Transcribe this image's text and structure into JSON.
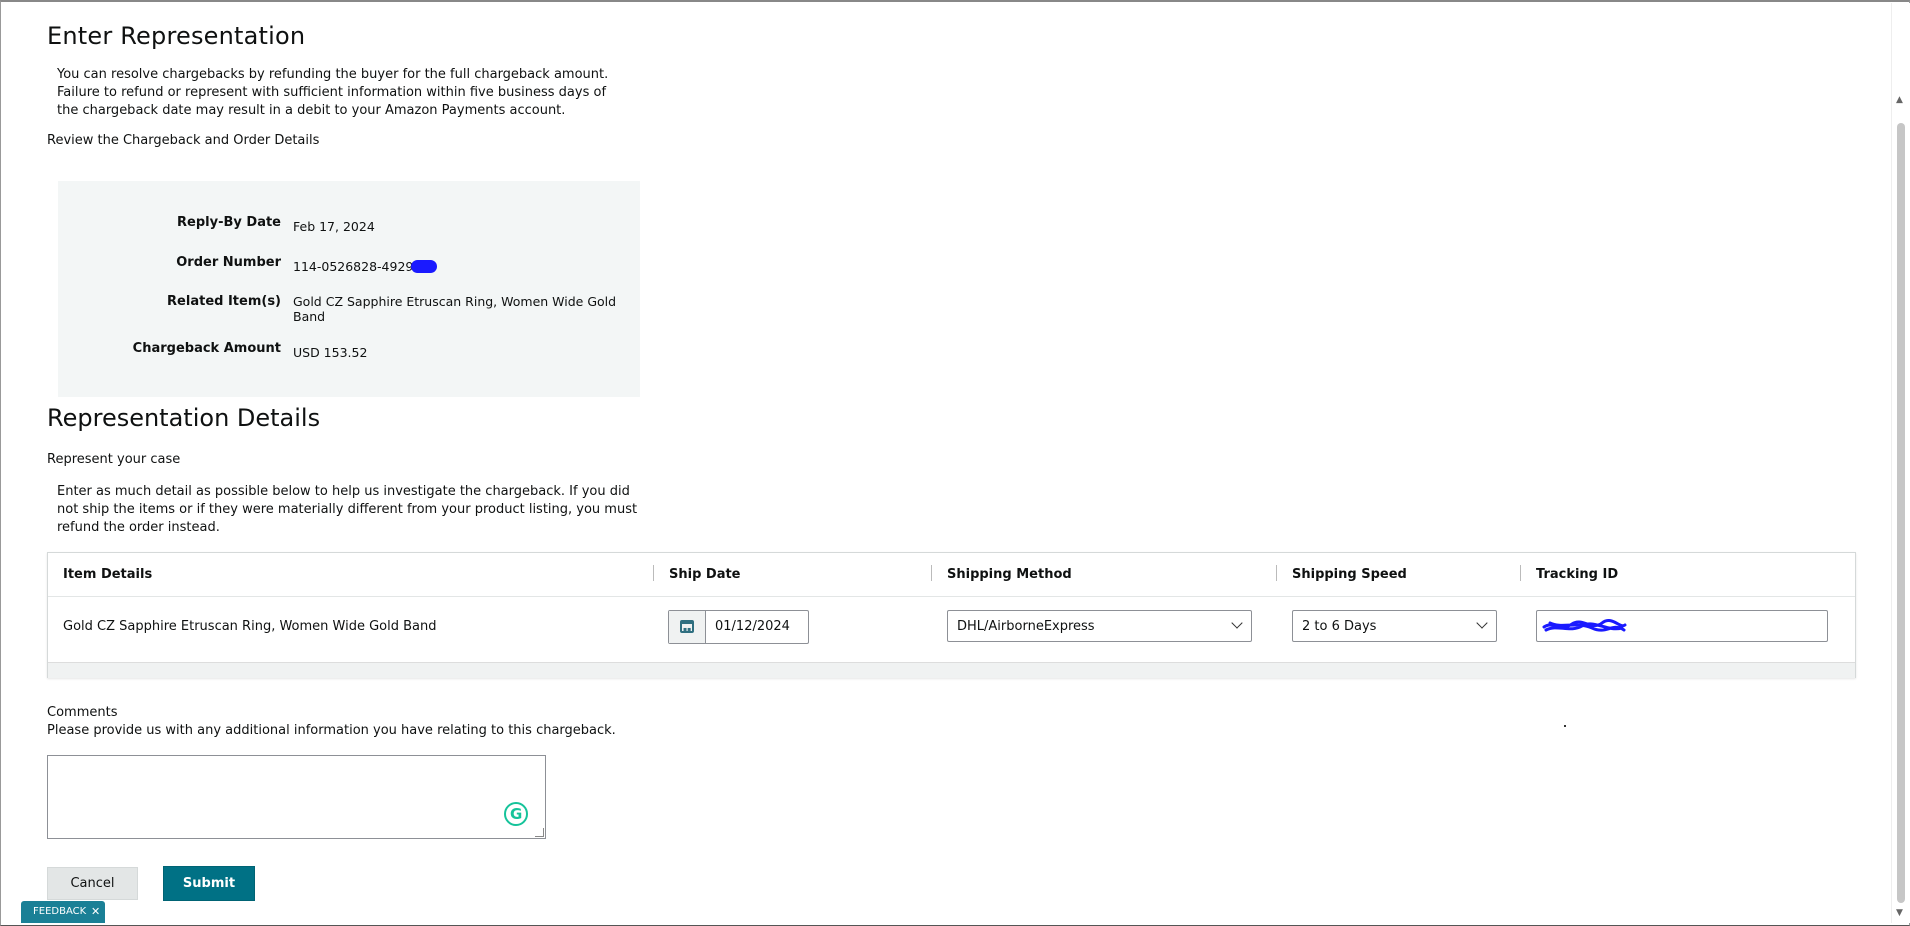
{
  "page": {
    "title": "Enter Representation",
    "intro": "You can resolve chargebacks by refunding the buyer for the full chargeback amount. Failure to refund or represent with sufficient information within five business days of the chargeback date may result in a debit to your Amazon Payments account.",
    "review_heading": "Review the Chargeback and Order Details"
  },
  "details": {
    "reply_by_label": "Reply-By Date",
    "reply_by_value": "Feb 17, 2024",
    "order_number_label": "Order Number",
    "order_number_value": "114-0526828-4929",
    "related_items_label": "Related Item(s)",
    "related_items_value": "Gold CZ Sapphire Etruscan Ring, Women Wide Gold Band",
    "chargeback_amount_label": "Chargeback Amount",
    "chargeback_amount_value": "USD 153.52"
  },
  "representation": {
    "title": "Representation Details",
    "subtitle": "Represent your case",
    "instructions": "Enter as much detail as possible below to help us investigate the chargeback. If you did not ship the items or if they were materially different from your product listing, you must refund the order instead."
  },
  "table": {
    "headers": [
      "Item Details",
      "Ship Date",
      "Shipping Method",
      "Shipping Speed",
      "Tracking ID"
    ],
    "row": {
      "item": "Gold CZ Sapphire Etruscan Ring, Women Wide Gold Band",
      "ship_date": "01/12/2024",
      "shipping_method": "DHL/AirborneExpress",
      "shipping_speed": "2 to 6 Days",
      "tracking_id": ""
    }
  },
  "comments": {
    "label": "Comments",
    "help": "Please provide us with any additional information you have relating to this chargeback.",
    "value": ""
  },
  "buttons": {
    "cancel": "Cancel",
    "submit": "Submit"
  },
  "feedback": {
    "label": "FEEDBACK",
    "close": "✕"
  },
  "icons": {
    "calendar": "calendar-icon",
    "dropdown": "chevron-down-icon",
    "grammarly": "grammarly-icon",
    "grammarly_letter": "G"
  },
  "colors": {
    "accent": "#007185",
    "details_bg": "#f3f6f6",
    "feedback_bg": "#1a8096",
    "redaction": "#1a1aff"
  }
}
